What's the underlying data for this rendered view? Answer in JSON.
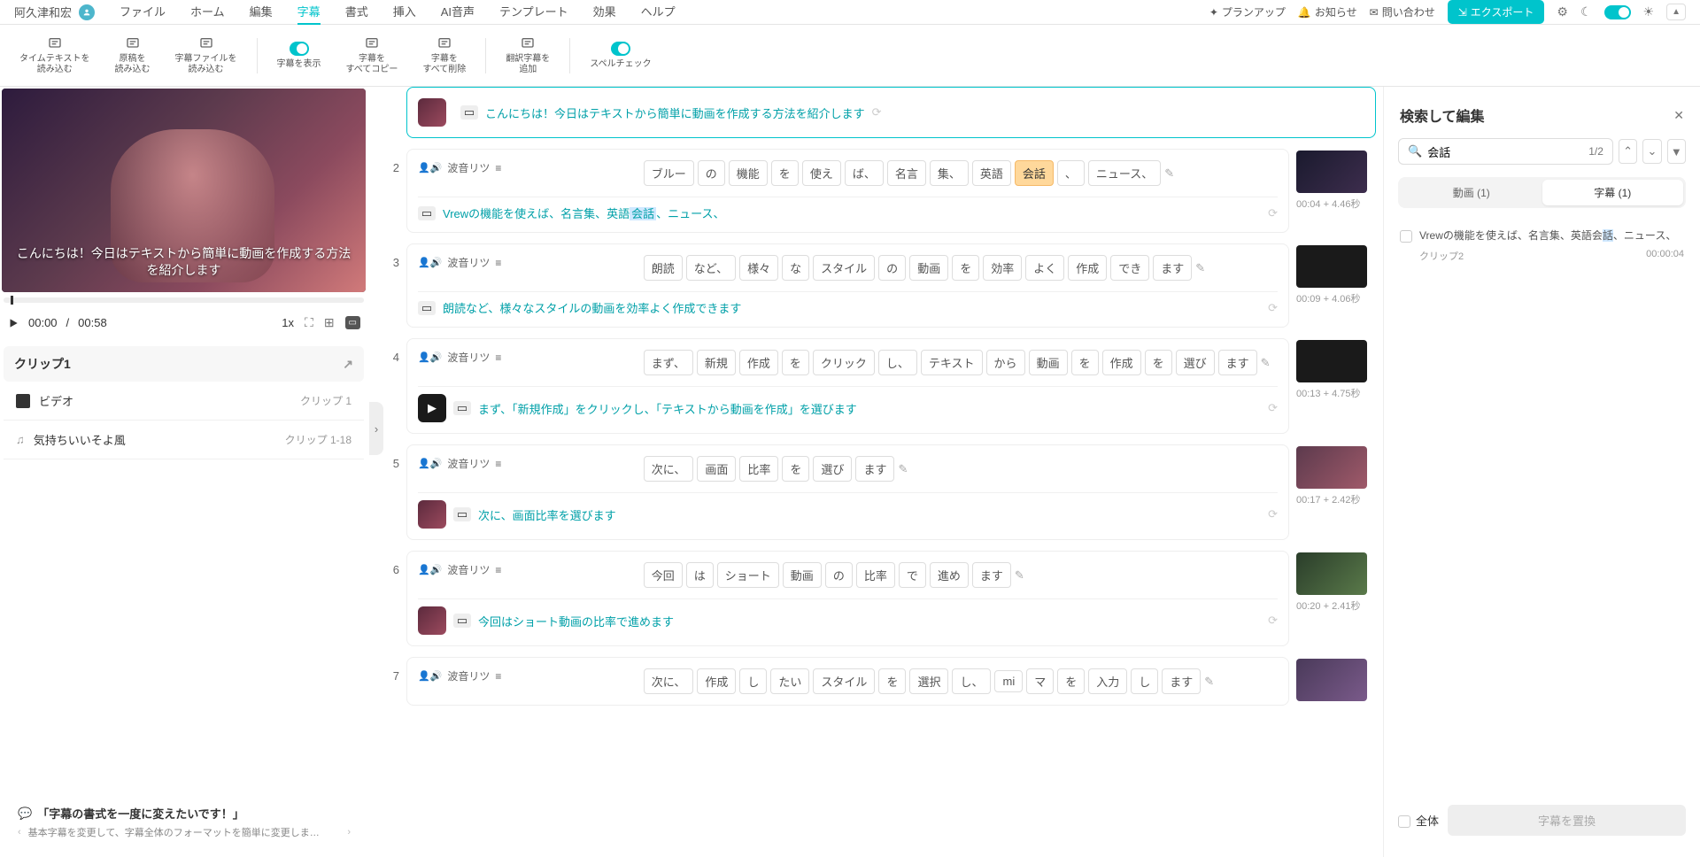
{
  "user": {
    "name": "阿久津和宏"
  },
  "menu": [
    "ファイル",
    "ホーム",
    "編集",
    "字幕",
    "書式",
    "挿入",
    "AI音声",
    "テンプレート",
    "効果",
    "ヘルプ"
  ],
  "menu_active_index": 3,
  "topbar": {
    "plan": "プランアップ",
    "notice": "お知らせ",
    "contact": "問い合わせ",
    "export": "エクスポート"
  },
  "ribbon": [
    {
      "label": "タイムテキストを\n読み込む",
      "type": "btn"
    },
    {
      "label": "原稿を\n読み込む",
      "type": "btn"
    },
    {
      "label": "字幕ファイルを\n読み込む",
      "type": "btn"
    },
    {
      "label": "字幕を表示",
      "type": "toggle"
    },
    {
      "label": "字幕を\nすべてコピー",
      "type": "btn"
    },
    {
      "label": "字幕を\nすべて削除",
      "type": "btn"
    },
    {
      "label": "翻訳字幕を\n追加",
      "type": "btn"
    },
    {
      "label": "スペルチェック",
      "type": "toggle"
    }
  ],
  "preview": {
    "subtitle": "こんにちは！今日はテキストから簡単に動画を作成する方法を紹介します",
    "current_time": "00:00",
    "total_time": "00:58",
    "speed": "1x"
  },
  "clip_panel": {
    "title": "クリップ1",
    "items": [
      {
        "icon": "video",
        "label": "ビデオ",
        "right": "クリップ 1"
      },
      {
        "icon": "music",
        "label": "気持ちいいそよ風",
        "right": "クリップ 1-18"
      }
    ]
  },
  "tip": {
    "title": "「字幕の書式を一度に変えたいです！」",
    "desc": "基本字幕を変更して、字幕全体のフォーマットを簡単に変更しま…"
  },
  "clips": [
    {
      "num": "",
      "active": true,
      "voice": "",
      "words": [],
      "subtitle_html": "こんにちは！今日はテキストから簡単に動画を作成する方法を紹介します",
      "time": "",
      "avatar": true
    },
    {
      "num": "2",
      "voice": "波音リツ",
      "words": [
        [
          "ブルー",
          ""
        ],
        [
          "の",
          ""
        ],
        [
          "機能",
          ""
        ],
        [
          "を",
          ""
        ],
        [
          "使え",
          ""
        ],
        [
          "ば、",
          ""
        ],
        [
          "名言",
          ""
        ],
        [
          "集、",
          ""
        ],
        [
          "英語",
          ""
        ],
        [
          "会話",
          "highlight"
        ],
        [
          "、",
          ""
        ],
        [
          "ニュース、",
          ""
        ]
      ],
      "subtitle_parts": [
        "Vrewの機能を使えば、名言集、英語",
        "会話",
        "、ニュース、"
      ],
      "time": "00:04 + 4.46秒",
      "thumb_class": "t1"
    },
    {
      "num": "3",
      "voice": "波音リツ",
      "words": [
        [
          "朗読",
          ""
        ],
        [
          "など、",
          ""
        ],
        [
          "様々",
          ""
        ],
        [
          "な",
          ""
        ],
        [
          "スタイル",
          ""
        ],
        [
          "の",
          ""
        ],
        [
          "動画",
          ""
        ],
        [
          "を",
          ""
        ],
        [
          "効率",
          ""
        ],
        [
          "よく",
          ""
        ],
        [
          "作成",
          ""
        ],
        [
          "でき",
          ""
        ],
        [
          "ます",
          ""
        ]
      ],
      "subtitle_html": "朗読など、様々なスタイルの動画を効率よく作成できます",
      "time": "00:09 + 4.06秒",
      "thumb_class": "t3"
    },
    {
      "num": "4",
      "voice": "波音リツ",
      "words": [
        [
          "まず、",
          ""
        ],
        [
          "新規",
          ""
        ],
        [
          "作成",
          ""
        ],
        [
          "を",
          ""
        ],
        [
          "クリック",
          ""
        ],
        [
          "し、",
          ""
        ],
        [
          "テキスト",
          ""
        ],
        [
          "から",
          ""
        ],
        [
          "動画",
          ""
        ],
        [
          "を",
          ""
        ],
        [
          "作成",
          ""
        ],
        [
          "を",
          ""
        ],
        [
          "選び",
          ""
        ],
        [
          "ます",
          ""
        ]
      ],
      "subtitle_html": "まず、「新規作成」をクリックし、「テキストから動画を作成」を選びます",
      "time": "00:13 + 4.75秒",
      "thumb_class": "t3",
      "avatar_play": true
    },
    {
      "num": "5",
      "voice": "波音リツ",
      "words": [
        [
          "次に、",
          ""
        ],
        [
          "画面",
          ""
        ],
        [
          "比率",
          ""
        ],
        [
          "を",
          ""
        ],
        [
          "選び",
          ""
        ],
        [
          "ます",
          ""
        ]
      ],
      "subtitle_html": "次に、画面比率を選びます",
      "time": "00:17 + 2.42秒",
      "thumb_class": "t5",
      "avatar": true
    },
    {
      "num": "6",
      "voice": "波音リツ",
      "words": [
        [
          "今回",
          ""
        ],
        [
          "は",
          ""
        ],
        [
          "ショート",
          ""
        ],
        [
          "動画",
          ""
        ],
        [
          "の",
          ""
        ],
        [
          "比率",
          ""
        ],
        [
          "で",
          ""
        ],
        [
          "進め",
          ""
        ],
        [
          "ます",
          ""
        ]
      ],
      "subtitle_html": "今回はショート動画の比率で進めます",
      "time": "00:20 + 2.41秒",
      "thumb_class": "t6",
      "avatar": true
    },
    {
      "num": "7",
      "voice": "波音リツ",
      "words": [
        [
          "次に、",
          ""
        ],
        [
          "作成",
          ""
        ],
        [
          "し",
          ""
        ],
        [
          "たい",
          ""
        ],
        [
          "スタイル",
          ""
        ],
        [
          "を",
          ""
        ],
        [
          "選択",
          ""
        ],
        [
          "し、",
          ""
        ],
        [
          "mi",
          ""
        ],
        [
          "マ",
          ""
        ],
        [
          "を",
          ""
        ],
        [
          "入力",
          ""
        ],
        [
          "し",
          ""
        ],
        [
          "ます",
          ""
        ]
      ],
      "subtitle_html": "",
      "time": "",
      "thumb_class": "t7"
    }
  ],
  "search_panel": {
    "title": "検索して編集",
    "query": "会話",
    "count": "1/2",
    "tabs": [
      {
        "label": "動画 (1)",
        "active": false
      },
      {
        "label": "字幕 (1)",
        "active": true
      }
    ],
    "results": [
      {
        "text_parts": [
          "Vrewの機能を使えば、名言集、英語会",
          "話",
          "、ニュース、"
        ],
        "clip": "クリップ2",
        "time": "00:00:04"
      }
    ],
    "all_label": "全体",
    "replace_label": "字幕を置換"
  }
}
